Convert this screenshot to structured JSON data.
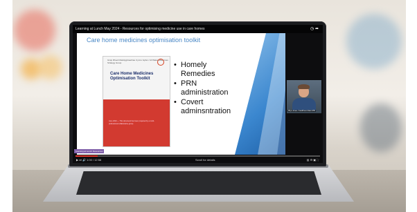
{
  "video": {
    "title": "Learning at Lunch May 2024 - Resources for optimising medicine use in care homes",
    "time": "1:00 / 12:58",
    "scroll_label": "Scroll for details",
    "progress_fraction": 0.09,
    "channel_label": "Learning at Lunch Resources"
  },
  "slide": {
    "title": "Care home medicines optimisation toolkit",
    "doc_header": "Grwp Rheoli Meddyginiaethau Cymru Gyfan / All Wales Medicines Strategy Group",
    "doc_title": "Care Home Medicines Optimisation Toolkit",
    "doc_small": "June 2024 — This document has been prepared by a multi-professional collaborative group",
    "bullets": [
      "Homely Remedies",
      "PRN administration",
      "Covert adminsntration"
    ]
  },
  "participant": {
    "name": "Rhys Jones / Cardiff and Vale UHB"
  },
  "colors": {
    "accent_blue": "#4a88c6",
    "doc_red": "#d23a30",
    "progress_red": "#e53a2f"
  }
}
